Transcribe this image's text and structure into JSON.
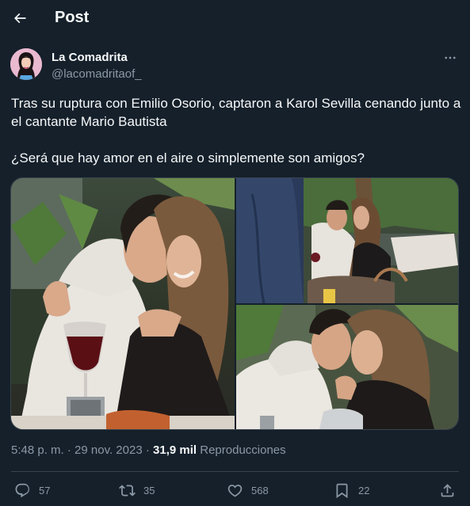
{
  "header": {
    "title": "Post",
    "back_icon": "arrow-left-icon"
  },
  "author": {
    "name": "La Comadrita",
    "handle": "@lacomadritaof_",
    "avatar_bg": "#e8b7cf"
  },
  "tweet": {
    "paragraph1": "Tras su ruptura con Emilio Osorio, captaron a Karol Sevilla cenando junto a el cantante Mario Bautista",
    "paragraph2": "¿Será que hay amor en el aire o simplemente son amigos?"
  },
  "media": {
    "photo_count": 3
  },
  "meta": {
    "time": "5:48 p. m.",
    "separator": "·",
    "date": "29 nov. 2023",
    "views_count": "31,9 mil",
    "views_label": "Reproducciones"
  },
  "actions": {
    "replies": "57",
    "retweets": "35",
    "likes": "568",
    "bookmarks": "22"
  },
  "colors": {
    "background": "#15202b",
    "text_primary": "#f7f9f9",
    "text_secondary": "#8b98a5",
    "border": "#38444d"
  }
}
